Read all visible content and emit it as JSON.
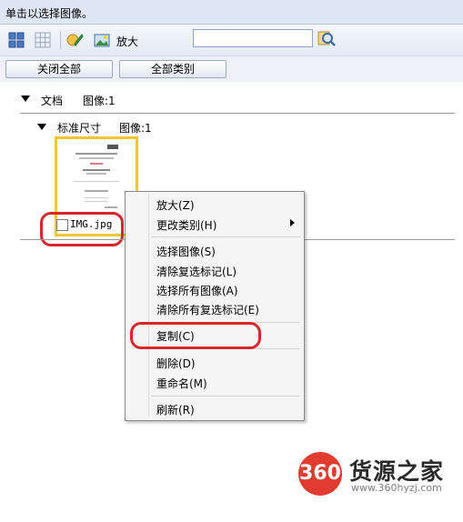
{
  "header": {
    "title": "单击以选择图像。"
  },
  "toolbar": {
    "icons": [
      "grid-view-icon",
      "grid-outline-icon",
      "edit-icon",
      "image-icon",
      "search-icon"
    ],
    "zoom_label": "放大",
    "search_value": ""
  },
  "buttons": {
    "close_all": "关闭全部",
    "all_categories": "全部类别"
  },
  "tree": {
    "group_label": "文档",
    "group_count": "图像:1",
    "subgroup_label": "标准尺寸",
    "subgroup_count": "图像:1"
  },
  "thumbnail": {
    "filename": "IMG.jpg"
  },
  "context_menu": {
    "items": [
      "放大(Z)",
      "更改类别(H)",
      "选择图像(S)",
      "清除复选标记(L)",
      "选择所有图像(A)",
      "清除所有复选标记(E)",
      "复制(C)",
      "删除(D)",
      "重命名(M)",
      "刷新(R)"
    ]
  },
  "watermark": {
    "badge": "360",
    "name": "货源之家",
    "url": "www.360hyzj.com"
  },
  "colors": {
    "header_bg": "#dfe6f3",
    "highlight_red": "#d9262b",
    "thumbnail_border": "#f2c531",
    "menu_bg": "#f5f5f5"
  }
}
